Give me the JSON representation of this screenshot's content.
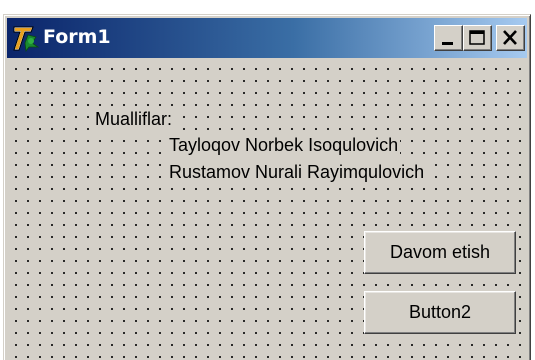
{
  "window": {
    "title": "Form1",
    "icon": "delphi-app-icon",
    "caption_buttons": {
      "minimize": "minimize-icon",
      "maximize": "maximize-icon",
      "close": "close-icon"
    }
  },
  "form": {
    "labels": {
      "title": "Mualliflar:",
      "author1": "Tayloqov Norbek Isoqulovich",
      "author2": "Rustamov Nurali Rayimqulovich"
    },
    "buttons": {
      "continue": "Davom etish",
      "button2": "Button2"
    }
  },
  "colors": {
    "face": "#d4d0c8",
    "title_start": "#0a246a",
    "title_end": "#a6caf0",
    "title_text": "#ffffff"
  }
}
